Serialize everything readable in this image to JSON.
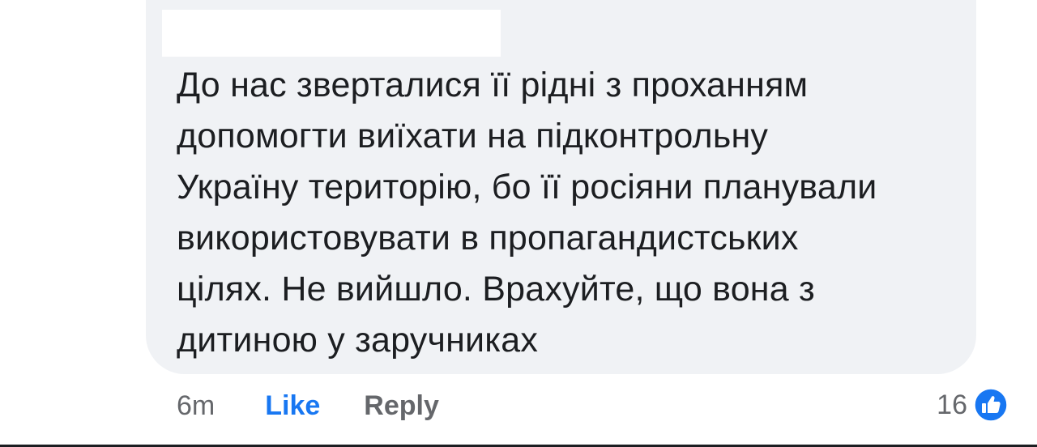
{
  "comment": {
    "text_lines": [
      "До нас зверталися її рідні з проханням",
      "допомогти виїхати на підконтрольну",
      "Україну територію, бо її росіяни планували",
      "використовувати в пропагандистських",
      "цілях. Не вийшло. Врахуйте, що вона з",
      "дитиною у заручниках"
    ]
  },
  "actions": {
    "time": "6m",
    "like_label": "Like",
    "reply_label": "Reply"
  },
  "reactions": {
    "count": "16",
    "icon": "like-thumbs-up-icon",
    "icon_color": "#1877f2"
  },
  "colors": {
    "bubble": "#f0f2f5",
    "text": "#1c1e21",
    "secondary": "#65676b",
    "accent": "#1877f2"
  }
}
